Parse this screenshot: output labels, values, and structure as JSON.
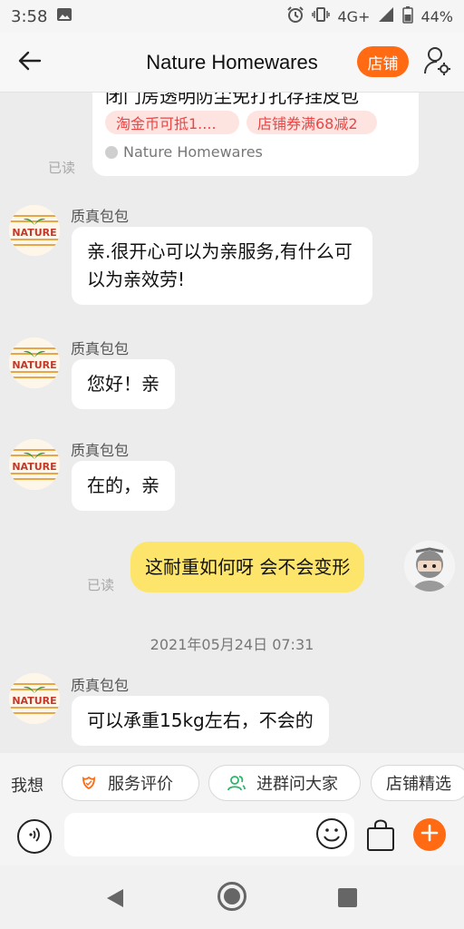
{
  "status_bar": {
    "time": "3:58",
    "network": "4G+",
    "battery": "44%",
    "icons": [
      "image-icon",
      "alarm-icon",
      "vibrate-icon",
      "signal-icon",
      "battery-icon"
    ]
  },
  "header": {
    "title": "Nature Homewares",
    "shop_button": "店铺",
    "icons": [
      "back-arrow-icon",
      "user-settings-icon"
    ]
  },
  "product_card": {
    "title": "闭门房透明防尘免打孔存挂皮包",
    "promos": [
      "淘金币可抵1....",
      "店铺券满68减2"
    ],
    "shop_name": "Nature Homewares"
  },
  "messages": [
    {
      "type": "read_receipt",
      "text": "已读"
    },
    {
      "type": "incoming",
      "sender": "质真包包",
      "text": "亲.很开心可以为亲服务,有什么可以为亲效劳!"
    },
    {
      "type": "incoming",
      "sender": "质真包包",
      "text": "您好！亲"
    },
    {
      "type": "incoming",
      "sender": "质真包包",
      "text": "在的，亲"
    },
    {
      "type": "outgoing",
      "read": "已读",
      "text": "这耐重如何呀 会不会变形"
    },
    {
      "type": "timestamp",
      "text": "2021年05月24日 07:31"
    },
    {
      "type": "incoming",
      "sender": "质真包包",
      "text": "可以承重15kg左右，不会的"
    }
  ],
  "quick_bar": {
    "label": "我想",
    "chips": [
      {
        "label": "服务评价",
        "icon": "flower-icon"
      },
      {
        "label": "进群问大家",
        "icon": "group-icon"
      },
      {
        "label": "店铺精选",
        "icon": ""
      }
    ]
  },
  "input_bar": {
    "placeholder": "",
    "icons": [
      "voice-icon",
      "emoji-icon",
      "shopping-bag-icon",
      "plus-icon"
    ]
  },
  "colors": {
    "accent": "#ff6a13",
    "outgoing_bubble": "#fde56b",
    "promo_bg": "#fde4e1",
    "promo_text": "#e94646"
  }
}
